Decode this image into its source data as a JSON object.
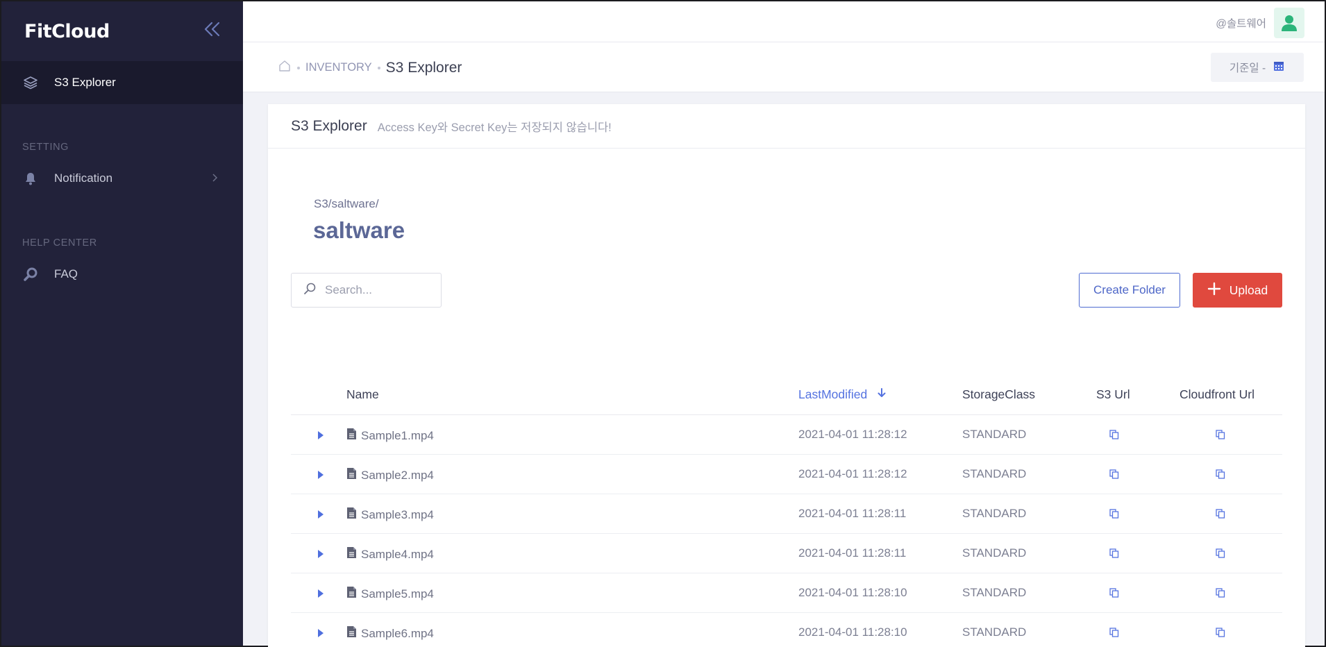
{
  "brand": "FitCloud",
  "sidebar": {
    "items": [
      {
        "label": "S3 Explorer",
        "icon": "layers-icon",
        "active": true
      }
    ],
    "sections": [
      {
        "title": "SETTING",
        "items": [
          {
            "label": "Notification",
            "icon": "bell-icon"
          }
        ]
      },
      {
        "title": "HELP CENTER",
        "items": [
          {
            "label": "FAQ",
            "icon": "search-icon"
          }
        ]
      }
    ]
  },
  "topbar": {
    "user": "@솔트웨어",
    "avatar": "user-avatar-icon"
  },
  "breadcrumb": {
    "parent": "INVENTORY",
    "current": "S3 Explorer"
  },
  "date_button": {
    "label": "기준일 -"
  },
  "panel": {
    "title": "S3 Explorer",
    "subtitle": "Access Key와 Secret Key는 저장되지 않습니다!",
    "path": "S3/saltware/",
    "folder": "saltware",
    "search_placeholder": "Search...",
    "create_folder_label": "Create Folder",
    "upload_label": "Upload"
  },
  "table": {
    "columns": {
      "name": "Name",
      "last_modified": "LastModified",
      "storage_class": "StorageClass",
      "s3_url": "S3 Url",
      "cloudfront_url": "Cloudfront Url"
    },
    "rows": [
      {
        "name": "Sample1.mp4",
        "date": "2021-04-01 11:28:12",
        "class": "STANDARD"
      },
      {
        "name": "Sample2.mp4",
        "date": "2021-04-01 11:28:12",
        "class": "STANDARD"
      },
      {
        "name": "Sample3.mp4",
        "date": "2021-04-01 11:28:11",
        "class": "STANDARD"
      },
      {
        "name": "Sample4.mp4",
        "date": "2021-04-01 11:28:11",
        "class": "STANDARD"
      },
      {
        "name": "Sample5.mp4",
        "date": "2021-04-01 11:28:10",
        "class": "STANDARD"
      },
      {
        "name": "Sample6.mp4",
        "date": "2021-04-01 11:28:10",
        "class": "STANDARD"
      }
    ]
  },
  "colors": {
    "sidebar_bg": "#22223a",
    "accent": "#5472e0",
    "upload": "#e0493e"
  }
}
